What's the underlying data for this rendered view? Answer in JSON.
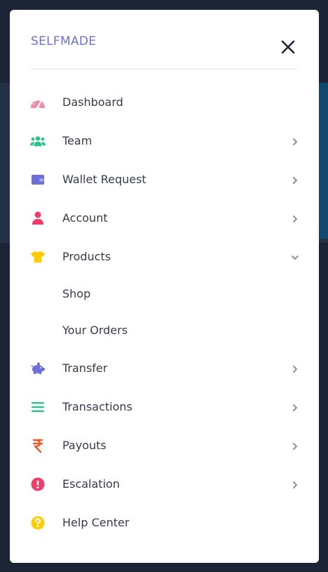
{
  "brand": "SELFMADE",
  "menu": {
    "dashboard": {
      "label": "Dashboard",
      "icon": "gauge-icon",
      "color": "#f08cab"
    },
    "team": {
      "label": "Team",
      "icon": "users-icon",
      "color": "#2cc489"
    },
    "wallet": {
      "label": "Wallet Request",
      "icon": "wallet-icon",
      "color": "#6c70d8"
    },
    "account": {
      "label": "Account",
      "icon": "user-icon",
      "color": "#ef3c68"
    },
    "products": {
      "label": "Products",
      "icon": "tshirt-icon",
      "color": "#ffcc00",
      "expanded": true
    },
    "shop": {
      "label": "Shop"
    },
    "orders": {
      "label": "Your Orders"
    },
    "transfer": {
      "label": "Transfer",
      "icon": "piggy-bank-icon",
      "color": "#6c70d8"
    },
    "transactions": {
      "label": "Transactions",
      "icon": "list-icon",
      "color": "#2cc489"
    },
    "payouts": {
      "label": "Payouts",
      "icon": "rupee-icon",
      "color": "#f05a28"
    },
    "escalation": {
      "label": "Escalation",
      "icon": "exclamation-circle-icon",
      "color": "#ef3c68"
    },
    "help": {
      "label": "Help Center",
      "icon": "question-circle-icon",
      "color": "#ffcc00"
    }
  }
}
